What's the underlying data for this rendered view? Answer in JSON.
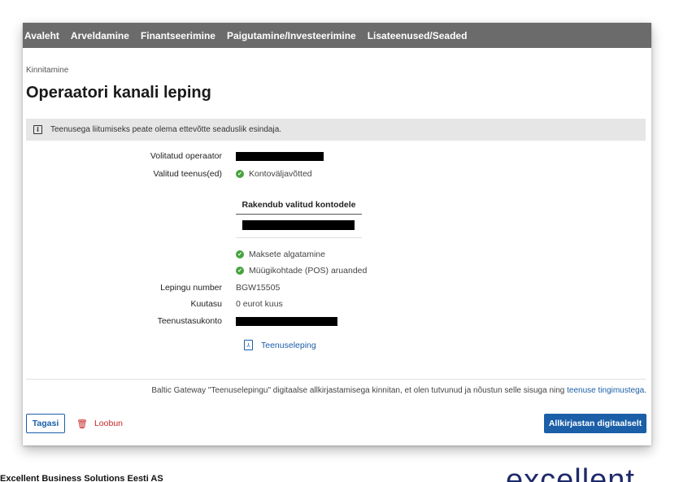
{
  "nav": {
    "items": [
      "Avaleht",
      "Arveldamine",
      "Finantseerimine",
      "Paigutamine/Investeerimine",
      "Lisateenused/Seaded"
    ]
  },
  "breadcrumb": "Kinnitamine",
  "page_title": "Operaatori kanali leping",
  "notice": {
    "icon": "info-icon",
    "text": "Teenusega liitumiseks peate olema ettevõtte seaduslik esindaja."
  },
  "form": {
    "operator_label": "Volitatud operaator",
    "services_label": "Valitud teenus(ed)",
    "service_1": "Kontoväljavõtted",
    "accounts_header": "Rakendub valitud kontodele",
    "service_2": "Maksete algatamine",
    "service_3": "Müügikohtade (POS) aruanded",
    "contract_number_label": "Lepingu number",
    "contract_number": "BGW15505",
    "monthly_fee_label": "Kuutasu",
    "monthly_fee": "0 eurot kuus",
    "fee_account_label": "Teenustasukonto",
    "service_contract_link": "Teenuseleping"
  },
  "consent": {
    "text": "Baltic Gateway \"Teenuselepingu\" digitaalse allkirjastamisega kinnitan, et olen tutvunud ja nõustun selle sisuga ning",
    "link": "teenuse tingimustega"
  },
  "actions": {
    "back": "Tagasi",
    "cancel": "Loobun",
    "sign": "Allkirjastan digitaalselt"
  },
  "footer": {
    "company": "Excellent Business Solutions Eesti AS",
    "logo": "excellent"
  },
  "colors": {
    "nav_bg": "#6b6b6b",
    "accent": "#1b5fa8",
    "success": "#48a23f",
    "danger": "#c62828"
  }
}
